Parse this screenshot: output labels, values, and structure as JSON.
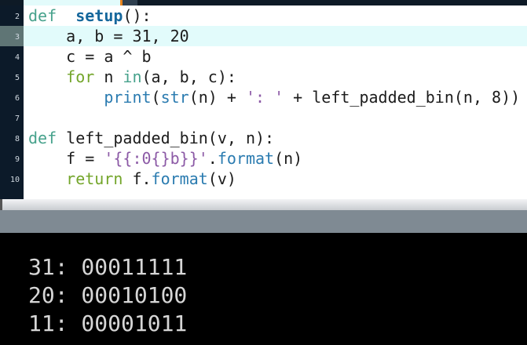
{
  "editor": {
    "lines": [
      {
        "num": "2",
        "tokens": [
          [
            "kw-def",
            "def"
          ],
          [
            "",
            "  "
          ],
          [
            "fn",
            "setup"
          ],
          [
            "",
            "():"
          ]
        ]
      },
      {
        "num": "3",
        "highlighted": true,
        "tokens": [
          [
            "",
            "    a, b = 31, 20"
          ]
        ]
      },
      {
        "num": "4",
        "tokens": [
          [
            "",
            "    c = a ^ b"
          ]
        ]
      },
      {
        "num": "5",
        "tokens": [
          [
            "",
            "    "
          ],
          [
            "kw",
            "for"
          ],
          [
            "",
            " n "
          ],
          [
            "kw-def",
            "in"
          ],
          [
            "",
            "(a, b, c):"
          ]
        ]
      },
      {
        "num": "6",
        "tokens": [
          [
            "",
            "        "
          ],
          [
            "bi",
            "print"
          ],
          [
            "",
            "("
          ],
          [
            "bi",
            "str"
          ],
          [
            "",
            "(n) + "
          ],
          [
            "str",
            "': '"
          ],
          [
            "",
            " + left_padded_bin(n, 8))"
          ]
        ]
      },
      {
        "num": "7",
        "tokens": []
      },
      {
        "num": "8",
        "tokens": [
          [
            "kw-def",
            "def"
          ],
          [
            "",
            " left_padded_bin(v, n):"
          ]
        ]
      },
      {
        "num": "9",
        "tokens": [
          [
            "",
            "    f = "
          ],
          [
            "str",
            "'{{:0{}b}}'"
          ],
          [
            "",
            "."
          ],
          [
            "bi",
            "format"
          ],
          [
            "",
            "(n)"
          ]
        ]
      },
      {
        "num": "10",
        "tokens": [
          [
            "",
            "    "
          ],
          [
            "kw",
            "return"
          ],
          [
            "",
            " f."
          ],
          [
            "bi",
            "format"
          ],
          [
            "",
            "(v)"
          ]
        ]
      }
    ]
  },
  "console": {
    "output": [
      "31: 00011111",
      "20: 00010100",
      "11: 00001011"
    ]
  },
  "colors": {
    "keyword_def": "#47a28c",
    "function_name": "#15679c",
    "keyword": "#73a52a",
    "builtin": "#2a7bb0",
    "string": "#8c5aa6",
    "current_line": "#e2fbfb",
    "gutter": "#0c1a29",
    "console_bg": "#000000",
    "console_text": "#d6d6d6"
  }
}
